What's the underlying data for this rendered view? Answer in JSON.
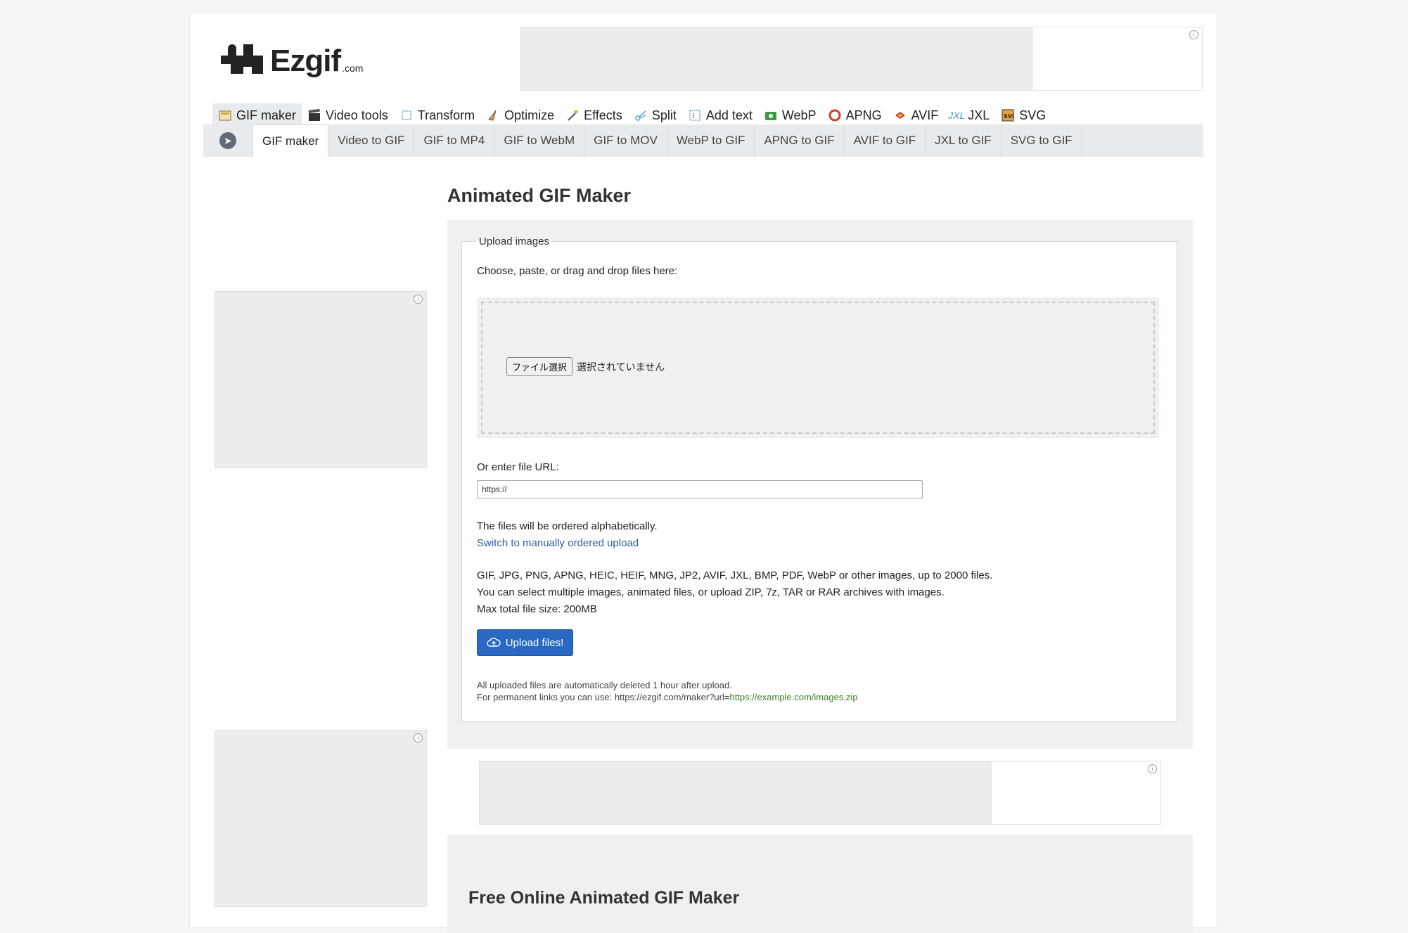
{
  "logo": {
    "text": "Ezgif",
    "suffix": ".com"
  },
  "main_menu": [
    {
      "label": "GIF maker",
      "icon": "gif-maker-icon",
      "active": true
    },
    {
      "label": "Video tools",
      "icon": "clapperboard-icon"
    },
    {
      "label": "Transform",
      "icon": "crop-icon"
    },
    {
      "label": "Optimize",
      "icon": "broom-icon"
    },
    {
      "label": "Effects",
      "icon": "magic-wand-icon"
    },
    {
      "label": "Split",
      "icon": "scissors-icon"
    },
    {
      "label": "Add text",
      "icon": "text-frame-icon"
    },
    {
      "label": "WebP",
      "icon": "webp-icon"
    },
    {
      "label": "APNG",
      "icon": "apng-icon"
    },
    {
      "label": "AVIF",
      "icon": "avif-icon"
    },
    {
      "label": "JXL",
      "icon": "jxl-icon"
    },
    {
      "label": "SVG",
      "icon": "svg-icon"
    }
  ],
  "sub_menu": [
    {
      "label": "GIF maker",
      "active": true
    },
    {
      "label": "Video to GIF"
    },
    {
      "label": "GIF to MP4"
    },
    {
      "label": "GIF to WebM"
    },
    {
      "label": "GIF to MOV"
    },
    {
      "label": "WebP to GIF"
    },
    {
      "label": "APNG to GIF"
    },
    {
      "label": "AVIF to GIF"
    },
    {
      "label": "JXL to GIF"
    },
    {
      "label": "SVG to GIF"
    }
  ],
  "page_title": "Animated GIF Maker",
  "upload": {
    "legend": "Upload images",
    "choose_text": "Choose, paste, or drag and drop files here:",
    "file_button": "ファイル選択",
    "file_status": "選択されていません",
    "url_label": "Or enter file URL:",
    "url_value": "https://",
    "order_text": "The files will be ordered alphabetically.",
    "switch_link": "Switch to manually ordered upload",
    "formats_line1": "GIF, JPG, PNG, APNG, HEIC, HEIF, MNG, JP2, AVIF, JXL, BMP, PDF, WebP or other images, up to 2000 files.",
    "formats_line2": "You can select multiple images, animated files, or upload ZIP, 7z, TAR or RAR archives with images.",
    "formats_line3": "Max total file size: 200MB",
    "upload_button": "Upload files!",
    "note_line1": "All uploaded files are automatically deleted 1 hour after upload.",
    "note_line2_prefix": "For permanent links you can use: https://ezgif.com/maker?url=",
    "note_line2_link": "https://example.com/images.zip"
  },
  "section_title": "Free Online Animated GIF Maker",
  "ad_info": "i",
  "colors": {
    "accent": "#2969c4",
    "link": "#2f5d9d",
    "green_link": "#3a7d23"
  }
}
